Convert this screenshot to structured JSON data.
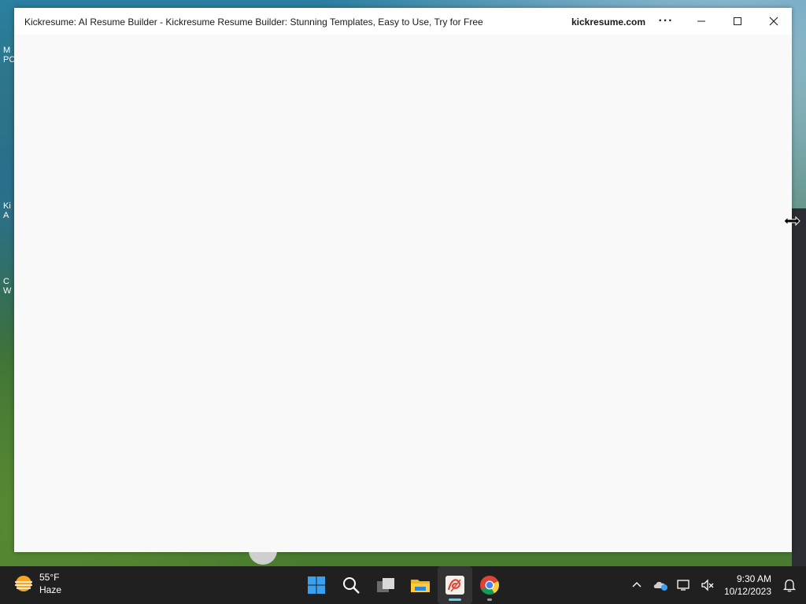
{
  "window": {
    "title": "Kickresume: AI Resume Builder - Kickresume Resume Builder: Stunning Templates, Easy to Use, Try for Free",
    "domain": "kickresume.com",
    "more_label": "···"
  },
  "desktop": {
    "icons": [
      {
        "label": "M PC"
      },
      {
        "label": "Ki A"
      },
      {
        "label": "C W"
      }
    ]
  },
  "taskbar": {
    "weather": {
      "temp": "55°F",
      "condition": "Haze"
    },
    "apps": [
      {
        "name": "start",
        "icon": "windows-start-icon"
      },
      {
        "name": "search",
        "icon": "search-icon"
      },
      {
        "name": "task-view",
        "icon": "task-view-icon"
      },
      {
        "name": "file-explorer",
        "icon": "folder-icon"
      },
      {
        "name": "kickresume",
        "icon": "kickresume-app-icon",
        "active": true
      },
      {
        "name": "chrome",
        "icon": "chrome-icon",
        "running": true
      }
    ],
    "clock": {
      "time": "9:30 AM",
      "date": "10/12/2023"
    }
  },
  "colors": {
    "taskbar_bg": "#202020",
    "window_bg": "#f9f9f9",
    "accent": "#60cdff"
  }
}
